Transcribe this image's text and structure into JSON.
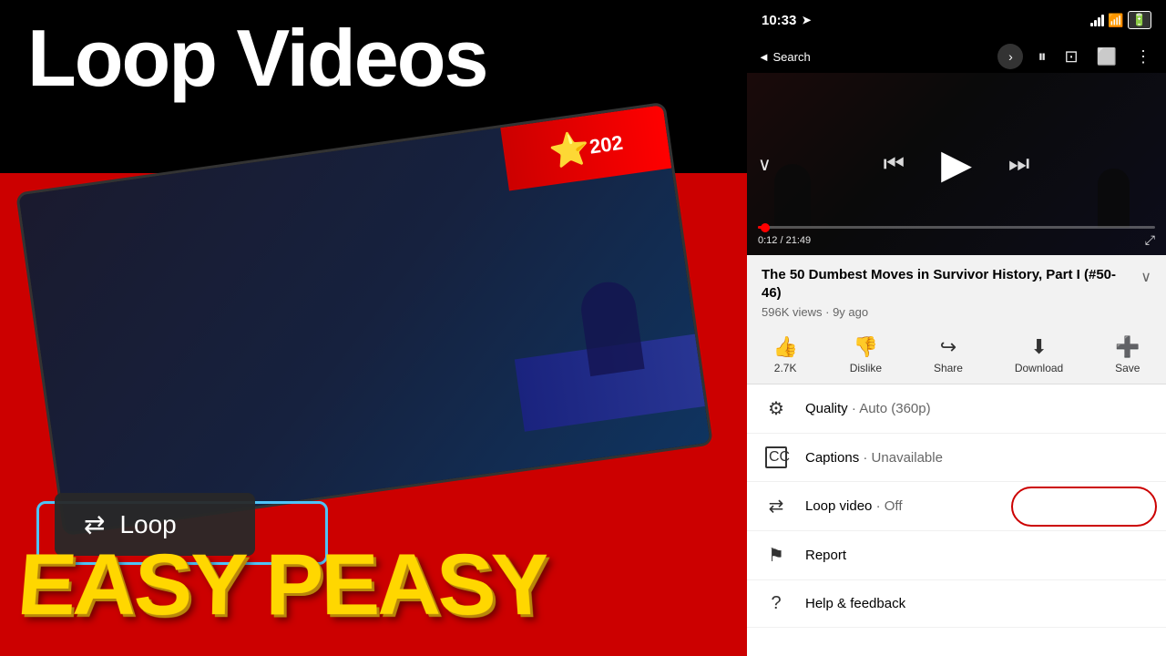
{
  "left": {
    "title": "Loop Videos",
    "easy_peasy": "EASY PEASY",
    "loop_label": "Loop"
  },
  "right": {
    "status_bar": {
      "time": "10:33",
      "nav_back": "◄ Search",
      "signal": "▲▲▲",
      "wifi": "wifi",
      "battery": "battery"
    },
    "video": {
      "time_current": "0:12",
      "time_total": "21:49",
      "title": "The 50 Dumbest Moves in Survivor History, Part I (#50-46)",
      "views": "596K views",
      "age": "9y ago"
    },
    "actions": {
      "like_count": "2.7K",
      "like_label": "Like",
      "dislike_label": "Dislike",
      "share_label": "Share",
      "download_label": "Download",
      "save_label": "Save"
    },
    "menu": {
      "quality_label": "Quality",
      "quality_value": "Auto (360p)",
      "captions_label": "Captions",
      "captions_value": "Unavailable",
      "loop_label": "Loop video",
      "loop_value": "Off",
      "report_label": "Report",
      "feedback_label": "Help & feedback"
    }
  }
}
